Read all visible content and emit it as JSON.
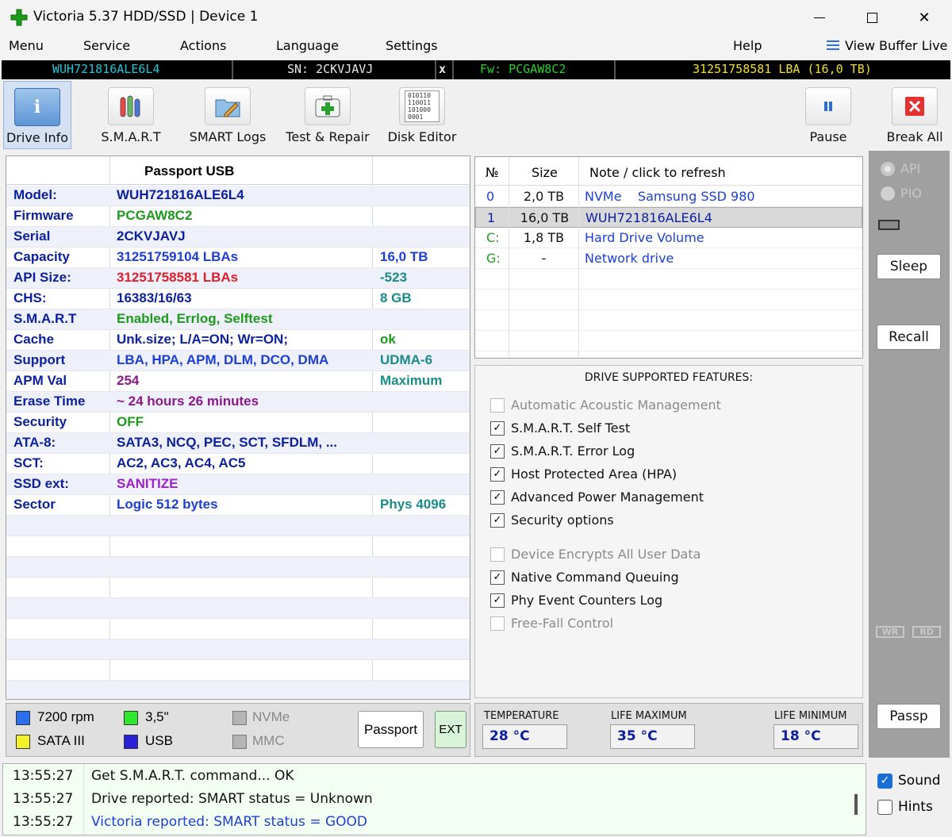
{
  "window": {
    "title": "Victoria 5.37 HDD/SSD | Device 1",
    "minimize": "—",
    "maximize": "☐",
    "close": "✕"
  },
  "menu": {
    "items": [
      "Menu",
      "Service",
      "Actions",
      "Language",
      "Settings",
      "Help"
    ],
    "view_buffer": "View Buffer Live"
  },
  "driveline": {
    "model": "WUH721816ALE6L4",
    "sn": "SN: 2CKVJAVJ",
    "x": "x",
    "fw": "Fw: PCGAW8C2",
    "lba": "31251758581 LBA (16,0 TB)"
  },
  "toolbar": {
    "drive_info": "Drive Info",
    "smart": "S.M.A.R.T",
    "smart_logs": "SMART Logs",
    "test_repair": "Test & Repair",
    "disk_editor": "Disk Editor",
    "pause": "Pause",
    "break_all": "Break All",
    "disk_editor_icon_text": "010110 110011 101000 0001"
  },
  "info": {
    "header": "Passport USB",
    "rows": [
      {
        "label": "Model:",
        "value": "WUH721816ALE6L4",
        "extra": "",
        "vcolor": "#0c1f9c",
        "ecolor": "#0c1f9c"
      },
      {
        "label": "Firmware",
        "value": "PCGAW8C2",
        "extra": "",
        "vcolor": "#1e9a1e",
        "ecolor": "#0c1f9c"
      },
      {
        "label": "Serial",
        "value": "2CKVJAVJ",
        "extra": "",
        "vcolor": "#0c1f9c",
        "ecolor": "#0c1f9c"
      },
      {
        "label": "Capacity",
        "value": "31251759104 LBAs",
        "extra": "16,0 TB",
        "vcolor": "#1d3fd6",
        "ecolor": "#1d3fd6"
      },
      {
        "label": "API Size:",
        "value": "31251758581 LBAs",
        "extra": "-523",
        "vcolor": "#e0202a",
        "ecolor": "#1b8a8a"
      },
      {
        "label": "CHS:",
        "value": "16383/16/63",
        "extra": "8 GB",
        "vcolor": "#0c1f9c",
        "ecolor": "#1b8a8a"
      },
      {
        "label": "S.M.A.R.T",
        "value": "Enabled, Errlog, Selftest",
        "extra": "",
        "vcolor": "#1e9a1e",
        "ecolor": "#0c1f9c"
      },
      {
        "label": "Cache",
        "value": "Unk.size; L/A=ON; Wr=ON;",
        "extra": "ok",
        "vcolor": "#0c1f9c",
        "ecolor": "#1e9a1e"
      },
      {
        "label": "Support",
        "value": "LBA, HPA, APM, DLM, DCO, DMA",
        "extra": "UDMA-6",
        "vcolor": "#1d3fd6",
        "ecolor": "#1b8a8a"
      },
      {
        "label": "APM Val",
        "value": "254",
        "extra": "Maximum",
        "vcolor": "#8a1a8a",
        "ecolor": "#1b8a8a"
      },
      {
        "label": "Erase Time",
        "value": "~ 24 hours 26 minutes",
        "extra": "",
        "vcolor": "#8a1a8a",
        "ecolor": "#0c1f9c"
      },
      {
        "label": "Security",
        "value": "OFF",
        "extra": "",
        "vcolor": "#1e9a1e",
        "ecolor": "#0c1f9c"
      },
      {
        "label": "ATA-8:",
        "value": "SATA3, NCQ, PEC, SCT, SFDLM, ...",
        "extra": "",
        "vcolor": "#0c1f9c",
        "ecolor": "#0c1f9c"
      },
      {
        "label": "SCT:",
        "value": "AC2, AC3, AC4, AC5",
        "extra": "",
        "vcolor": "#0c1f9c",
        "ecolor": "#0c1f9c"
      },
      {
        "label": "SSD ext:",
        "value": "SANITIZE",
        "extra": "",
        "vcolor": "#a020d0",
        "ecolor": "#0c1f9c"
      },
      {
        "label": "Sector",
        "value": "Logic 512 bytes",
        "extra": "Phys 4096",
        "vcolor": "#1d3fd6",
        "ecolor": "#1b8a8a"
      }
    ]
  },
  "indicators": {
    "rpm": "7200 rpm",
    "size": "3,5\"",
    "nvme": "NVMe",
    "sata": "SATA III",
    "usb": "USB",
    "mmc": "MMC",
    "passport_btn": "Passport",
    "ext_btn": "EXT"
  },
  "devices": {
    "headers": [
      "№",
      "Size",
      "Note / click to refresh"
    ],
    "rows": [
      {
        "id": "0",
        "size": "2,0 TB",
        "note": "NVMe    Samsung SSD 980",
        "color": "#1d3fd6",
        "selected": false
      },
      {
        "id": "1",
        "size": "16,0 TB",
        "note": "WUH721816ALE6L4",
        "color": "#0c1f9c",
        "selected": true
      },
      {
        "id": "C:",
        "size": "1,8 TB",
        "note": "Hard Drive Volume",
        "color": "#1e9a1e",
        "selected": false
      },
      {
        "id": "G:",
        "size": "-",
        "note": "Network drive",
        "color": "#1e9a1e",
        "selected": false
      }
    ]
  },
  "features": {
    "title": "DRIVE SUPPORTED FEATURES:",
    "items": [
      {
        "label": "Automatic Acoustic Management",
        "checked": false,
        "enabled": false
      },
      {
        "label": "S.M.A.R.T. Self Test",
        "checked": true,
        "enabled": true
      },
      {
        "label": "S.M.A.R.T. Error Log",
        "checked": true,
        "enabled": true
      },
      {
        "label": "Host Protected Area (HPA)",
        "checked": true,
        "enabled": true
      },
      {
        "label": "Advanced Power Management",
        "checked": true,
        "enabled": true
      },
      {
        "label": "Security options",
        "checked": true,
        "enabled": true
      },
      {
        "label": "Device Encrypts All User Data",
        "checked": false,
        "enabled": false
      },
      {
        "label": "Native Command Queuing",
        "checked": true,
        "enabled": true
      },
      {
        "label": "Phy Event Counters Log",
        "checked": true,
        "enabled": true
      },
      {
        "label": "Free-Fall Control",
        "checked": false,
        "enabled": false
      }
    ]
  },
  "temps": {
    "temperature_label": "TEMPERATURE",
    "temperature": "28 °C",
    "life_max_label": "LIFE MAXIMUM",
    "life_max": "35 °C",
    "life_min_label": "LIFE MINIMUM",
    "life_min": "18 °C"
  },
  "sidebar": {
    "api": "API",
    "pio": "PIO",
    "sleep": "Sleep",
    "recall": "Recall",
    "wr": "WR",
    "rd": "RD",
    "passp": "Passp"
  },
  "log": [
    {
      "time": "13:55:27",
      "msg": "Get S.M.A.R.T. command... OK",
      "color": "#111111"
    },
    {
      "time": "13:55:27",
      "msg": "Drive reported: SMART status = Unknown",
      "color": "#111111"
    },
    {
      "time": "13:55:27",
      "msg": "Victoria reported: SMART status = GOOD",
      "color": "#1d3fd6"
    }
  ],
  "options": {
    "sound": "Sound",
    "sound_checked": true,
    "hints": "Hints",
    "hints_checked": false
  }
}
